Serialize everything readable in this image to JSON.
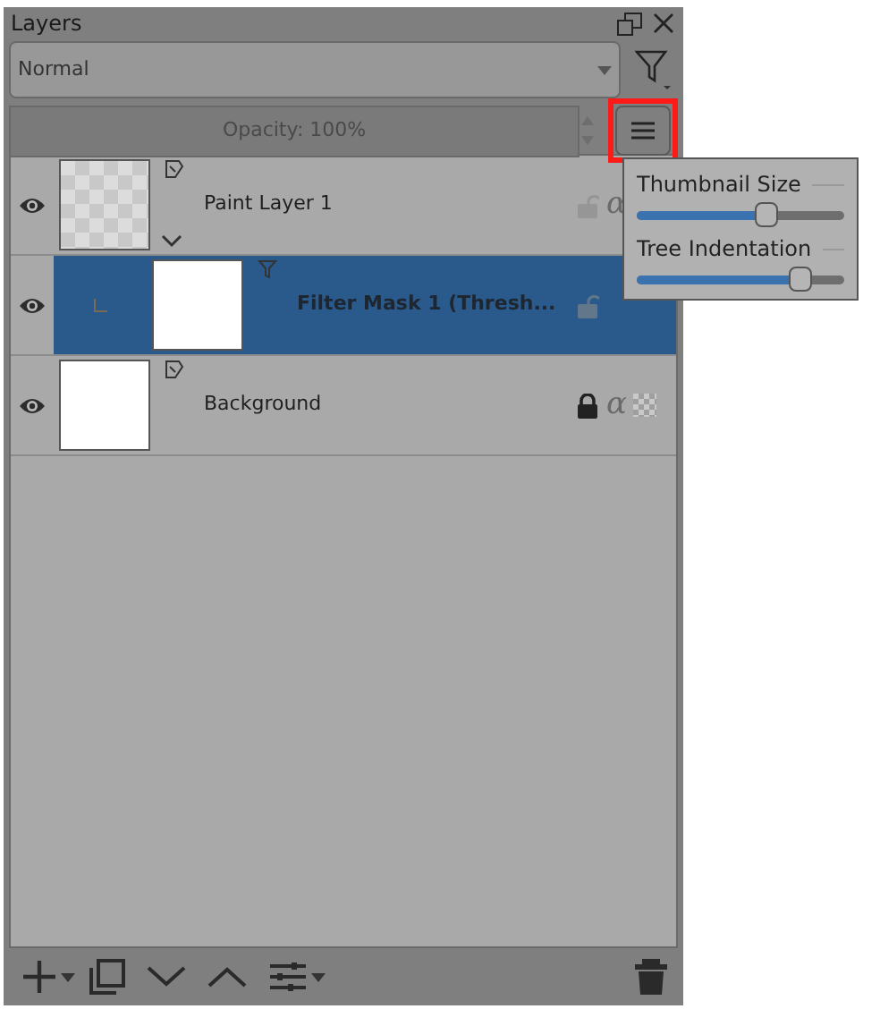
{
  "panel": {
    "title": "Layers"
  },
  "blend_mode": {
    "value": "Normal"
  },
  "opacity": {
    "value": "Opacity:  100%",
    "level": 1
  },
  "view_button": {
    "highlighted": true
  },
  "layers": [
    {
      "kind": "paint",
      "name": "Paint Layer 1",
      "selected": false,
      "locked": false,
      "expanded": true,
      "transparent": true,
      "indicators": [
        {
          "kind": "alpha",
          "text": "α"
        }
      ]
    },
    {
      "kind": "mask",
      "name": "Filter Mask 1 (Thresh...",
      "selected": true,
      "locked": false,
      "transparent": false
    },
    {
      "kind": "paint",
      "name": "Background",
      "selected": false,
      "locked": true,
      "expanded": false,
      "transparent": false,
      "indicators": [
        {
          "kind": "alpha",
          "text": "α"
        },
        {
          "kind": "checker"
        }
      ]
    }
  ],
  "view_menu": {
    "sliders": [
      {
        "label": "Thumbnail Size",
        "level": 0.63
      },
      {
        "label": "Tree Indentation",
        "level": 0.82
      }
    ]
  }
}
